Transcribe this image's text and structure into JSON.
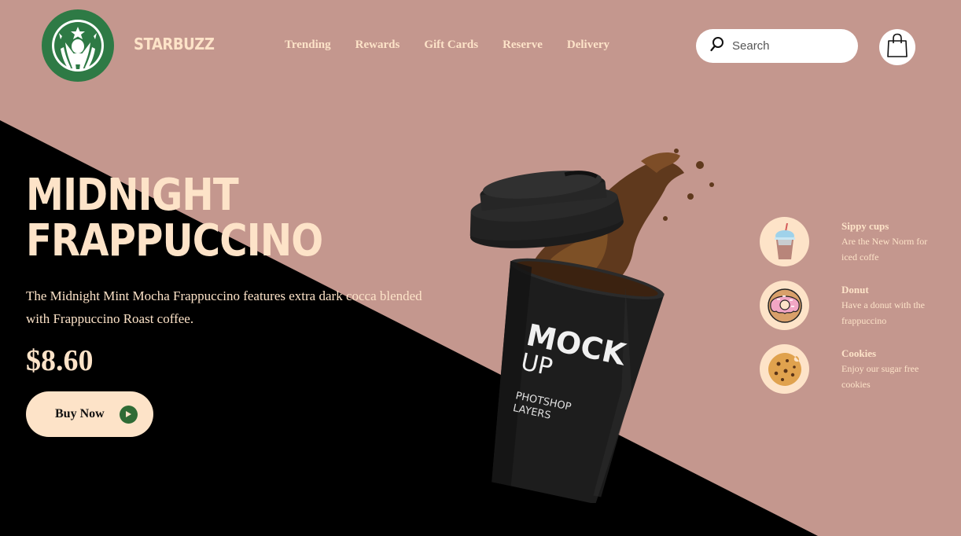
{
  "brand": {
    "name": "STARBUZZ",
    "logo_icon": "starbucks-siren-logo"
  },
  "nav": {
    "items": [
      "Trending",
      "Rewards",
      "Gift Cards",
      "Reserve",
      "Delivery"
    ]
  },
  "search": {
    "placeholder": "Search",
    "value": "",
    "icon": "search-icon"
  },
  "cart": {
    "icon": "shopping-bag-icon"
  },
  "hero": {
    "title_line1": "MIDNIGHT",
    "title_line2": "FRAPPUCCINO",
    "description": "The Midnight Mint Mocha Frappuccino features extra dark cocca blended with Frappuccino Roast coffee.",
    "price": "$8.60",
    "cta_label": "Buy Now",
    "cta_icon": "play-icon"
  },
  "product_image": {
    "cup_text_line1": "MOCK",
    "cup_text_line2": "UP",
    "cup_text_line3": "PHOTSHOP",
    "cup_text_line4": "LAYERS"
  },
  "side_items": [
    {
      "title": "Sippy cups",
      "text": "Are the New Norm for iced coffe",
      "icon": "sippy-cup-icon"
    },
    {
      "title": "Donut",
      "text": "Have a donut with the frappuccino",
      "icon": "donut-icon"
    },
    {
      "title": "Cookies",
      "text": "Enjoy our sugar free cookies",
      "icon": "cookie-icon"
    }
  ],
  "colors": {
    "background": "#c4978e",
    "dark": "#000000",
    "cream": "#fde3c8",
    "accent_green": "#2f6b35"
  }
}
